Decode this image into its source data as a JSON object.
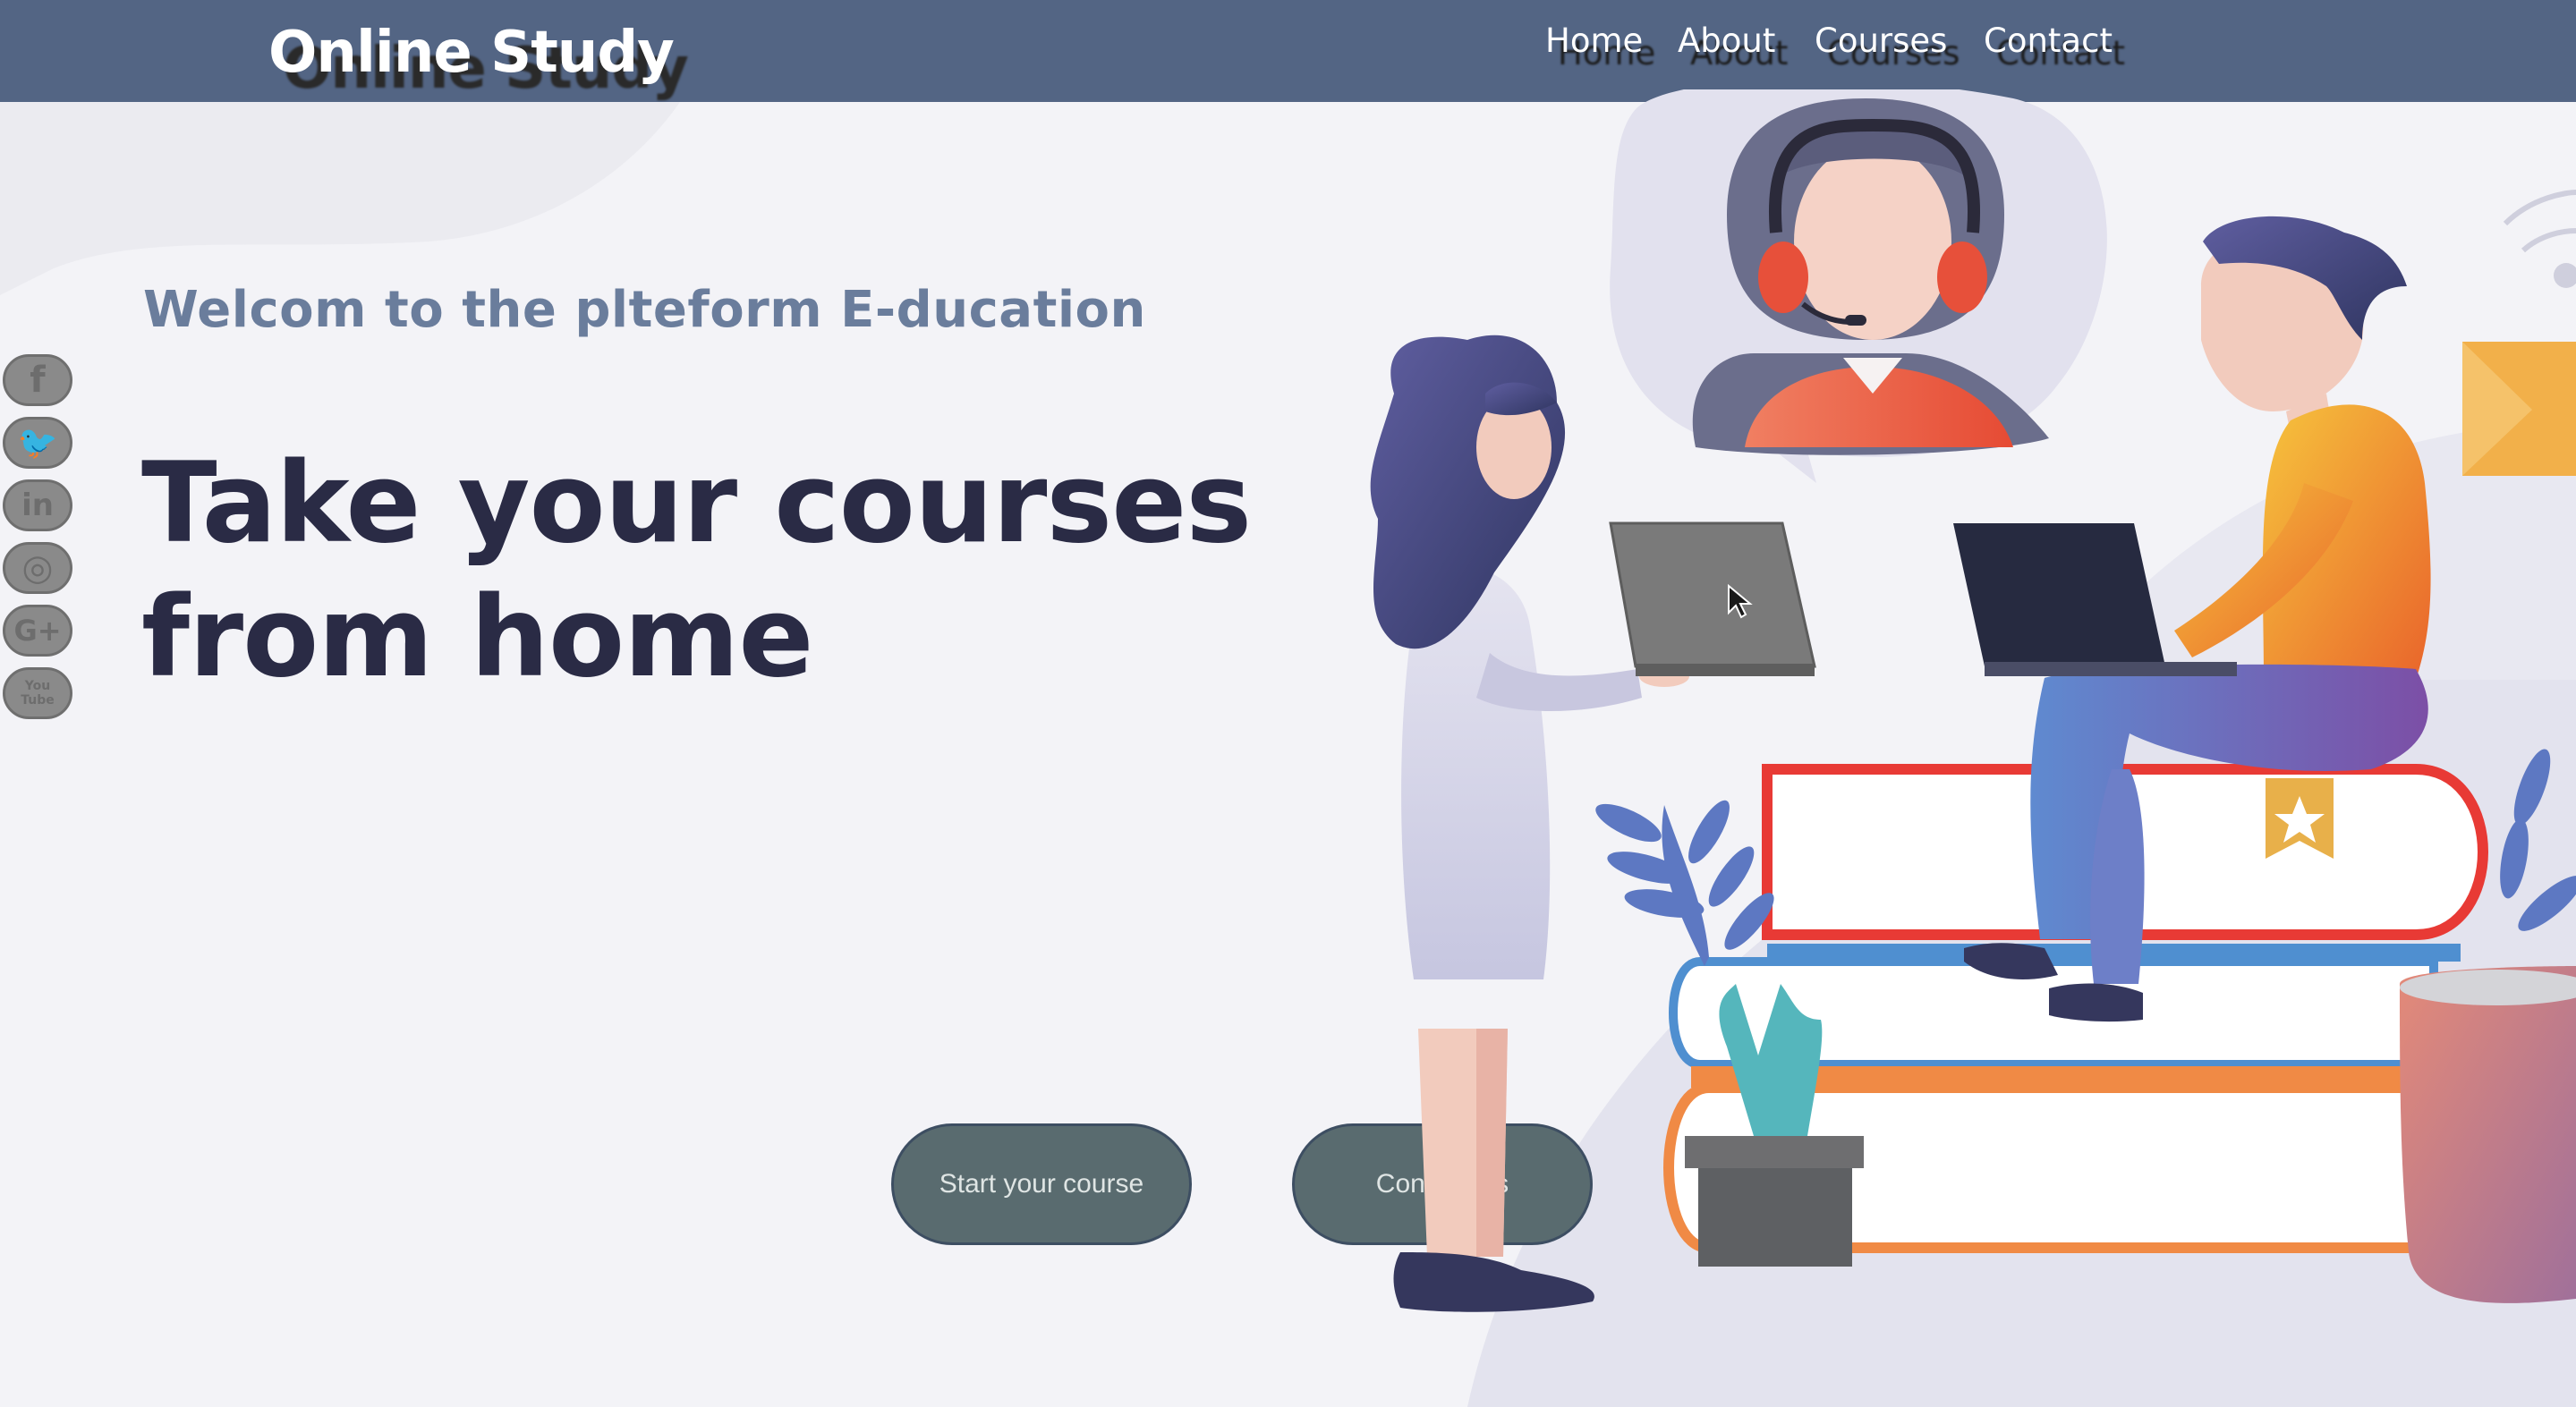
{
  "header": {
    "brand": "Online Study",
    "nav": [
      {
        "label": "Home"
      },
      {
        "label": "About"
      },
      {
        "label": "Courses"
      },
      {
        "label": "Contact"
      }
    ]
  },
  "social": [
    {
      "icon": "facebook-icon",
      "glyph": "f"
    },
    {
      "icon": "twitter-icon",
      "glyph": "🐦"
    },
    {
      "icon": "linkedin-icon",
      "glyph": "in"
    },
    {
      "icon": "instagram-icon",
      "glyph": "◎"
    },
    {
      "icon": "google-plus-icon",
      "glyph": "G+"
    },
    {
      "icon": "youtube-icon",
      "glyph": "You Tube"
    }
  ],
  "hero": {
    "welcome": "Welcom to the plteform E-ducation",
    "headline_line1": "Take your courses",
    "headline_line2": "from home",
    "start_button": "Start your course",
    "contact_button": "Contact Us"
  },
  "colors": {
    "navbar": "#536584",
    "welcome_text": "#6a7d9c",
    "headline_text": "#2a2b45",
    "button_fill": "#596b6f"
  }
}
